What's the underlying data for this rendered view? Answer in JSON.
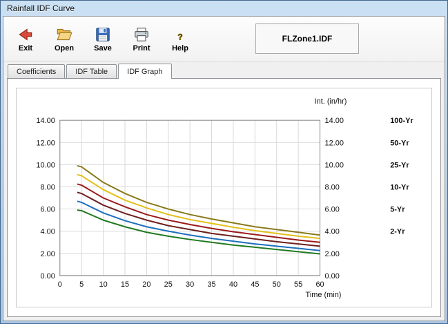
{
  "window": {
    "title": "Rainfall IDF Curve"
  },
  "toolbar": {
    "buttons": [
      {
        "label": "Exit",
        "icon": "exit-icon"
      },
      {
        "label": "Open",
        "icon": "open-folder-icon"
      },
      {
        "label": "Save",
        "icon": "save-disk-icon"
      },
      {
        "label": "Print",
        "icon": "printer-icon"
      },
      {
        "label": "Help",
        "icon": "help-icon"
      }
    ],
    "filename": "FLZone1.IDF"
  },
  "tabs": [
    {
      "label": "Coefficients",
      "active": false
    },
    {
      "label": "IDF Table",
      "active": false
    },
    {
      "label": "IDF Graph",
      "active": true
    }
  ],
  "chart_data": {
    "type": "line",
    "title": "",
    "xlabel": "Time (min)",
    "ylabel": "Int. (in/hr)",
    "xlim": [
      0,
      60
    ],
    "ylim": [
      0,
      14
    ],
    "x_ticks": [
      0,
      5,
      10,
      15,
      20,
      25,
      30,
      35,
      40,
      45,
      50,
      55,
      60
    ],
    "y_ticks": [
      0,
      2,
      4,
      6,
      8,
      10,
      12,
      14
    ],
    "grid": true,
    "grid_color": "#d8d8d8",
    "plot_border_color": "#7f7f7f",
    "legend_position": "right",
    "x": [
      4,
      5,
      10,
      15,
      20,
      25,
      30,
      35,
      40,
      45,
      50,
      55,
      60
    ],
    "series": [
      {
        "name": "100-Yr",
        "color": "#8a7a1b",
        "legend_row_value": 14,
        "values": [
          9.9,
          9.8,
          8.4,
          7.4,
          6.6,
          6.0,
          5.5,
          5.1,
          4.75,
          4.4,
          4.15,
          3.9,
          3.65
        ]
      },
      {
        "name": "50-Yr",
        "color": "#e3c01a",
        "legend_row_value": 12,
        "values": [
          9.1,
          9.0,
          7.75,
          6.8,
          6.1,
          5.5,
          5.05,
          4.7,
          4.35,
          4.05,
          3.8,
          3.55,
          3.35
        ]
      },
      {
        "name": "25-Yr",
        "color": "#9b1b1b",
        "legend_row_value": 10,
        "values": [
          8.25,
          8.15,
          7.0,
          6.2,
          5.5,
          5.0,
          4.6,
          4.25,
          3.95,
          3.7,
          3.45,
          3.2,
          3.0
        ]
      },
      {
        "name": "10-Yr",
        "color": "#6e1f1f",
        "legend_row_value": 8,
        "values": [
          7.5,
          7.4,
          6.35,
          5.6,
          5.0,
          4.5,
          4.15,
          3.8,
          3.55,
          3.3,
          3.05,
          2.85,
          2.65
        ]
      },
      {
        "name": "5-Yr",
        "color": "#1c6fbe",
        "legend_row_value": 6,
        "values": [
          6.7,
          6.6,
          5.65,
          4.95,
          4.4,
          4.0,
          3.65,
          3.35,
          3.1,
          2.85,
          2.65,
          2.45,
          2.25
        ]
      },
      {
        "name": "2-Yr",
        "color": "#227a22",
        "legend_row_value": 4,
        "values": [
          5.9,
          5.85,
          5.0,
          4.4,
          3.9,
          3.55,
          3.25,
          3.0,
          2.75,
          2.55,
          2.35,
          2.15,
          1.95
        ]
      }
    ]
  }
}
